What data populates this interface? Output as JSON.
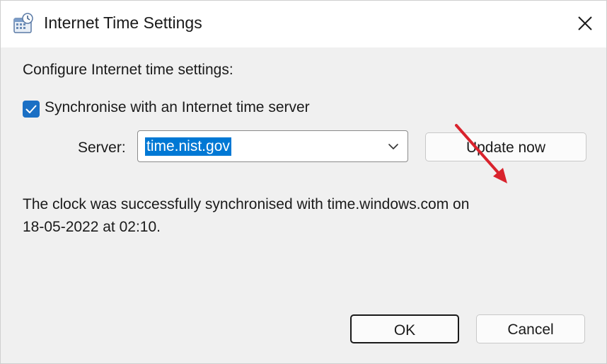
{
  "window": {
    "title": "Internet Time Settings",
    "title_icon": "clock-calendar-icon",
    "close_icon": "close-icon"
  },
  "content": {
    "heading": "Configure Internet time settings:",
    "sync_checkbox": {
      "checked": true,
      "label": "Synchronise with an Internet time server"
    },
    "server": {
      "label": "Server:",
      "value": "time.nist.gov",
      "dropdown_icon": "chevron-down-icon"
    },
    "update_button": "Update now",
    "status_line1": "The clock was successfully synchronised with time.windows.com on",
    "status_line2": "18-05-2022 at 02:10."
  },
  "footer": {
    "ok_label": "OK",
    "cancel_label": "Cancel"
  },
  "colors": {
    "accent": "#0078d4",
    "checkbox": "#1a6fc4",
    "annotation_arrow": "#d9232d"
  }
}
